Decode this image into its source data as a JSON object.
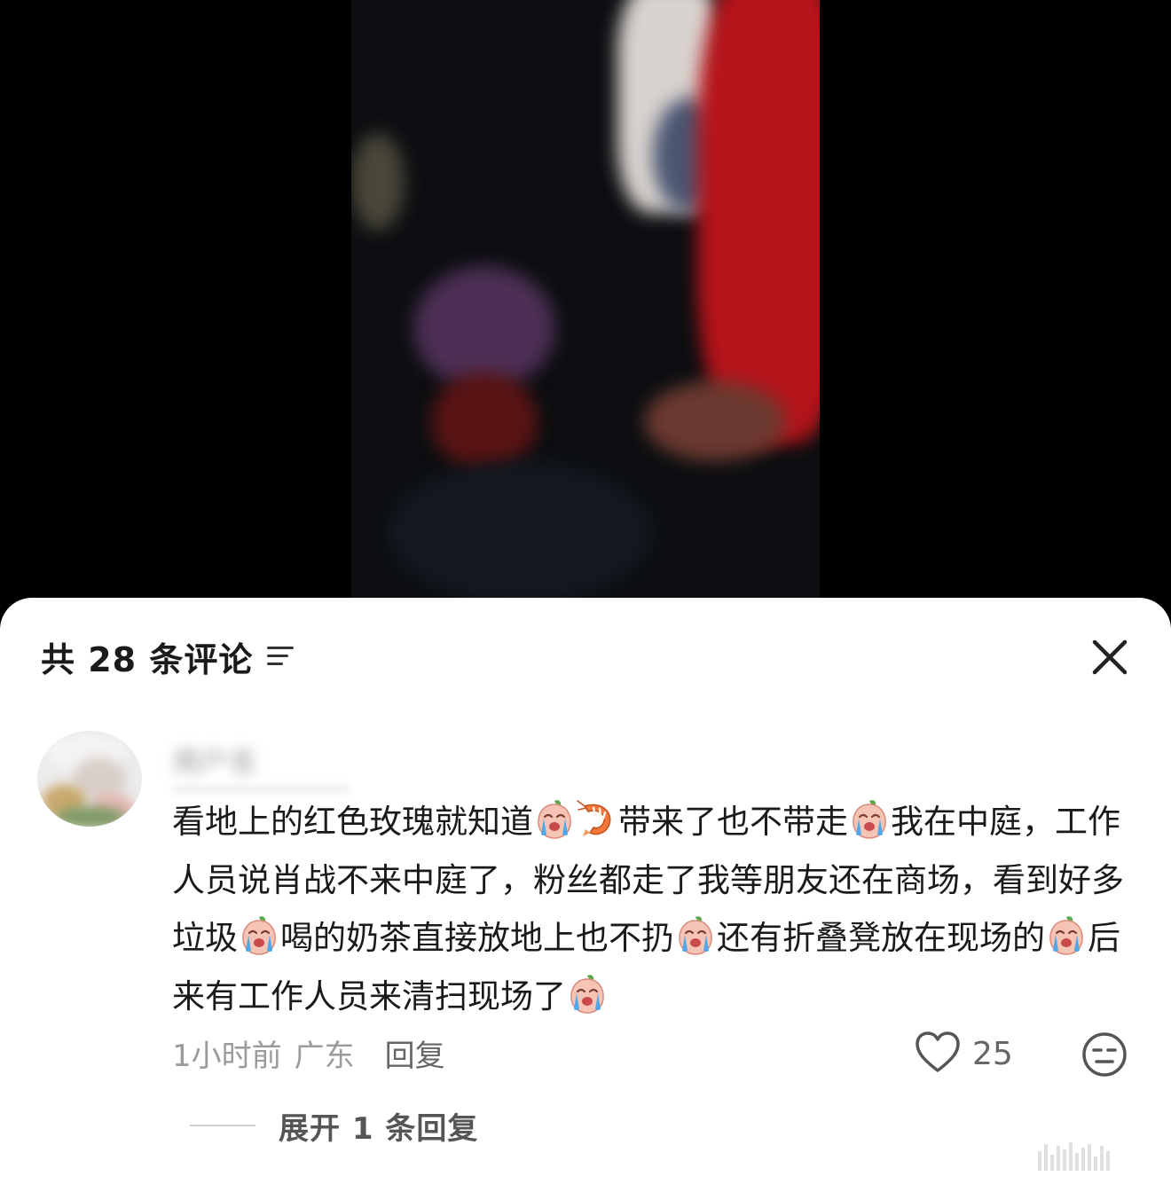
{
  "comments_panel": {
    "title": "共 28 条评论",
    "sort_icon": "sort-lines-icon",
    "close_icon": "close-x-icon"
  },
  "comment": {
    "username": "用户名",
    "segments": [
      {
        "t": "看地上的红色玫瑰就知道"
      },
      {
        "e": "crying-peach-emoji"
      },
      {
        "e": "shrimp-emoji"
      },
      {
        "t": "带来了也不带走"
      },
      {
        "e": "crying-peach-emoji"
      },
      {
        "t": "我在中庭，工作人员说肖战不来中庭了，粉丝都走了我等朋友还在商场，看到好多垃圾"
      },
      {
        "e": "crying-peach-emoji"
      },
      {
        "t": "喝的奶茶直接放地上也不扔"
      },
      {
        "e": "crying-peach-emoji"
      },
      {
        "t": "还有折叠凳放在现场的"
      },
      {
        "e": "crying-peach-emoji"
      },
      {
        "t": "后来有工作人员来清扫现场了"
      },
      {
        "e": "crying-peach-emoji"
      }
    ],
    "time": "1小时前",
    "location": "广东",
    "reply_label": "回复",
    "like_icon": "heart-outline-icon",
    "like_count": "25",
    "dislike_icon": "meh-face-icon",
    "expand_label": "展开 1 条回复"
  },
  "colors": {
    "sheet_background": "#ffffff",
    "video_background": "#000000",
    "primary_text": "#1a1a1a",
    "secondary_text": "#9b9b9b"
  }
}
